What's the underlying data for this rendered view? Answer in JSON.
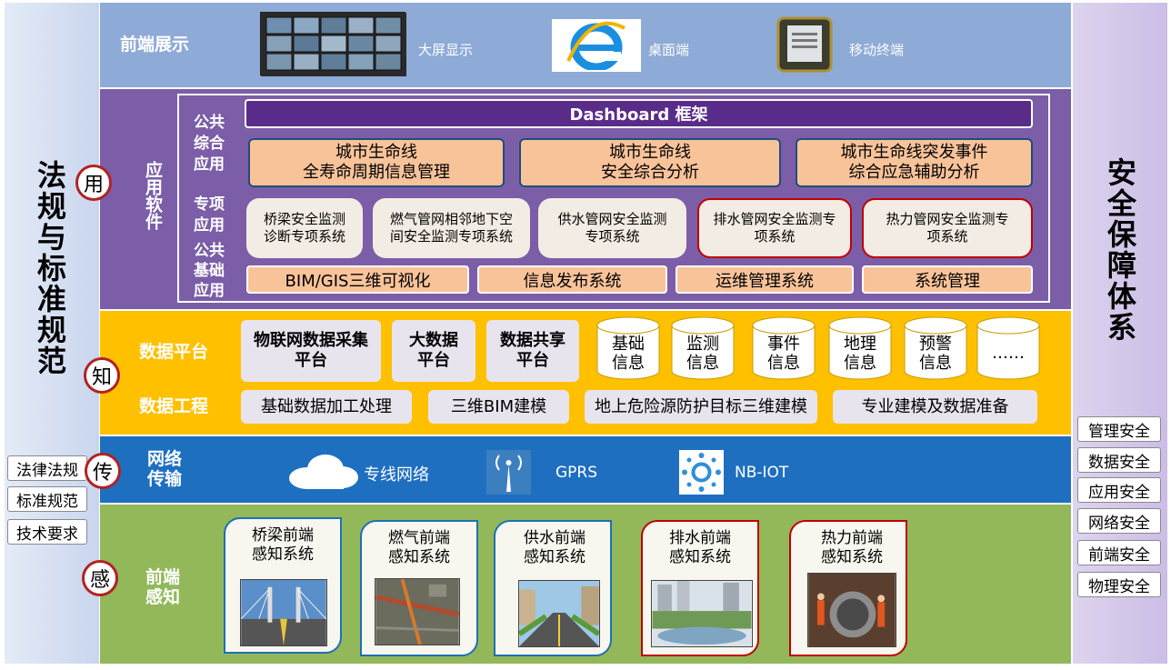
{
  "left_column": {
    "title": "法规与标准规范",
    "items": [
      "法律法规",
      "标准规范",
      "技术要求"
    ]
  },
  "right_column": {
    "title": "安全保障体系",
    "items": [
      "管理安全",
      "数据安全",
      "应用安全",
      "网络安全",
      "前端安全",
      "物理安全"
    ]
  },
  "badges": {
    "use": "用",
    "know": "知",
    "transmit": "传",
    "sense": "感"
  },
  "front_display": {
    "label": "前端展示",
    "items": [
      {
        "label": "大屏显示",
        "icon": "video-wall-icon"
      },
      {
        "label": "桌面端",
        "icon": "browser-e-icon"
      },
      {
        "label": "移动终端",
        "icon": "tablet-icon"
      }
    ]
  },
  "app_software": {
    "label": "应用软件",
    "public_label": "公共综合应用",
    "special_label": "专项应用",
    "base_label": "公共基础应用",
    "dashboard": "Dashboard 框架",
    "public_apps": [
      {
        "line1": "城市生命线",
        "line2": "全寿命周期信息管理"
      },
      {
        "line1": "城市生命线",
        "line2": "安全综合分析"
      },
      {
        "line1": "城市生命线突发事件",
        "line2": "综合应急辅助分析"
      }
    ],
    "special_apps": [
      {
        "line1": "桥梁安全监测",
        "line2": "诊断专项系统"
      },
      {
        "line1": "燃气管网相邻地下空",
        "line2": "间安全监测专项系统"
      },
      {
        "line1": "供水管网安全监测",
        "line2": "专项系统"
      },
      {
        "line1": "排水管网安全监测专",
        "line2": "项系统"
      },
      {
        "line1": "热力管网安全监测专",
        "line2": "项系统"
      }
    ],
    "base_apps": [
      "BIM/GIS三维可视化",
      "信息发布系统",
      "运维管理系统",
      "系统管理"
    ]
  },
  "data_platform": {
    "label": "数据平台",
    "platforms": [
      {
        "line1": "物联网数据采集",
        "line2": "平台"
      },
      {
        "line1": "大数据",
        "line2": "平台"
      },
      {
        "line1": "数据共享",
        "line2": "平台"
      }
    ],
    "databases": [
      {
        "line1": "基础",
        "line2": "信息"
      },
      {
        "line1": "监测",
        "line2": "信息"
      },
      {
        "line1": "事件",
        "line2": "信息"
      },
      {
        "line1": "地理",
        "line2": "信息"
      },
      {
        "line1": "预警",
        "line2": "信息"
      },
      {
        "line1": "……",
        "line2": ""
      }
    ]
  },
  "data_engineering": {
    "label": "数据工程",
    "items": [
      "基础数据加工处理",
      "三维BIM建模",
      "地上危险源防护目标三维建模",
      "专业建模及数据准备"
    ]
  },
  "network": {
    "label_line1": "网络",
    "label_line2": "传输",
    "items": [
      {
        "label": "专线网络",
        "icon": "cloud-icon"
      },
      {
        "label": "GPRS",
        "icon": "antenna-icon"
      },
      {
        "label": "NB-IOT",
        "icon": "iot-node-icon"
      }
    ]
  },
  "sensing": {
    "label_line1": "前端",
    "label_line2": "感知",
    "cards": [
      {
        "line1": "桥梁前端",
        "line2": "感知系统",
        "photo": "bridge-photo"
      },
      {
        "line1": "燃气前端",
        "line2": "感知系统",
        "photo": "gas-aerial-photo"
      },
      {
        "line1": "供水前端",
        "line2": "感知系统",
        "photo": "street-photo"
      },
      {
        "line1": "排水前端",
        "line2": "感知系统",
        "photo": "drainage-photo"
      },
      {
        "line1": "热力前端",
        "line2": "感知系统",
        "photo": "pipeline-photo"
      }
    ]
  }
}
